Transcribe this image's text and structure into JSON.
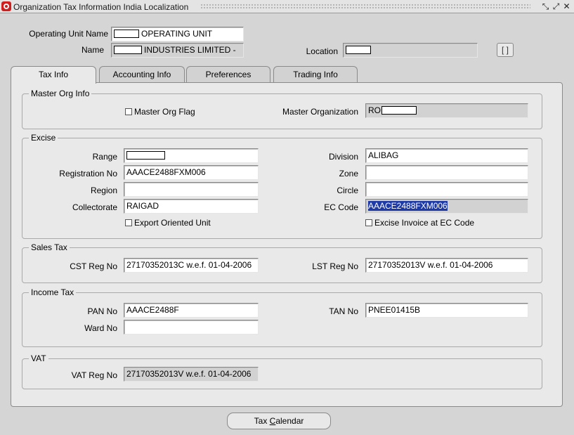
{
  "window": {
    "title": "Organization Tax Information India Localization",
    "controls": {
      "minimize": "⤡",
      "maximize": "⤢",
      "close": "✕"
    }
  },
  "header": {
    "operating_unit_label": "Operating Unit Name",
    "operating_unit_value": "OPERATING UNIT",
    "name_label": "Name",
    "name_value": "INDUSTRIES LIMITED -",
    "location_label": "Location",
    "location_value": "",
    "attach_button": "[ ]"
  },
  "tabs": [
    {
      "label": "Tax Info",
      "active": true
    },
    {
      "label": "Accounting  Info",
      "active": false
    },
    {
      "label": "Preferences",
      "active": false
    },
    {
      "label": "Trading Info",
      "active": false
    }
  ],
  "master_org": {
    "title": "Master Org Info",
    "flag_label": "Master Org Flag",
    "flag_checked": false,
    "organization_label": "Master Organization",
    "organization_value": "RO"
  },
  "excise": {
    "title": "Excise",
    "range_label": "Range",
    "range_value": "",
    "registration_label": "Registration No",
    "registration_value": "AAACE2488FXM006",
    "region_label": "Region",
    "region_value": "",
    "collectorate_label": "Collectorate",
    "collectorate_value": "RAIGAD",
    "division_label": "Division",
    "division_value": "ALIBAG",
    "zone_label": "Zone",
    "zone_value": "",
    "circle_label": "Circle",
    "circle_value": "",
    "ec_code_label": "EC Code",
    "ec_code_value": "AAACE2488FXM006",
    "export_label": "Export Oriented Unit",
    "export_checked": false,
    "excise_invoice_label": "Excise Invoice at EC Code",
    "excise_invoice_checked": false
  },
  "sales_tax": {
    "title": "Sales Tax",
    "cst_label": "CST Reg No",
    "cst_value": "27170352013C w.e.f. 01-04-2006",
    "lst_label": "LST Reg No",
    "lst_value": "27170352013V w.e.f. 01-04-2006"
  },
  "income_tax": {
    "title": "Income Tax",
    "pan_label": "PAN No",
    "pan_value": "AAACE2488F",
    "ward_label": "Ward No",
    "ward_value": "",
    "tan_label": "TAN No",
    "tan_value": "PNEE01415B"
  },
  "vat": {
    "title": "VAT",
    "reg_label": "VAT Reg No",
    "reg_value": "27170352013V w.e.f. 01-04-2006"
  },
  "buttons": {
    "tax_calendar_prefix": "Tax ",
    "tax_calendar_mnemonic": "C",
    "tax_calendar_suffix": "alendar"
  },
  "colors": {
    "selection": "#1d3aa6",
    "brand": "#d01f1f"
  }
}
